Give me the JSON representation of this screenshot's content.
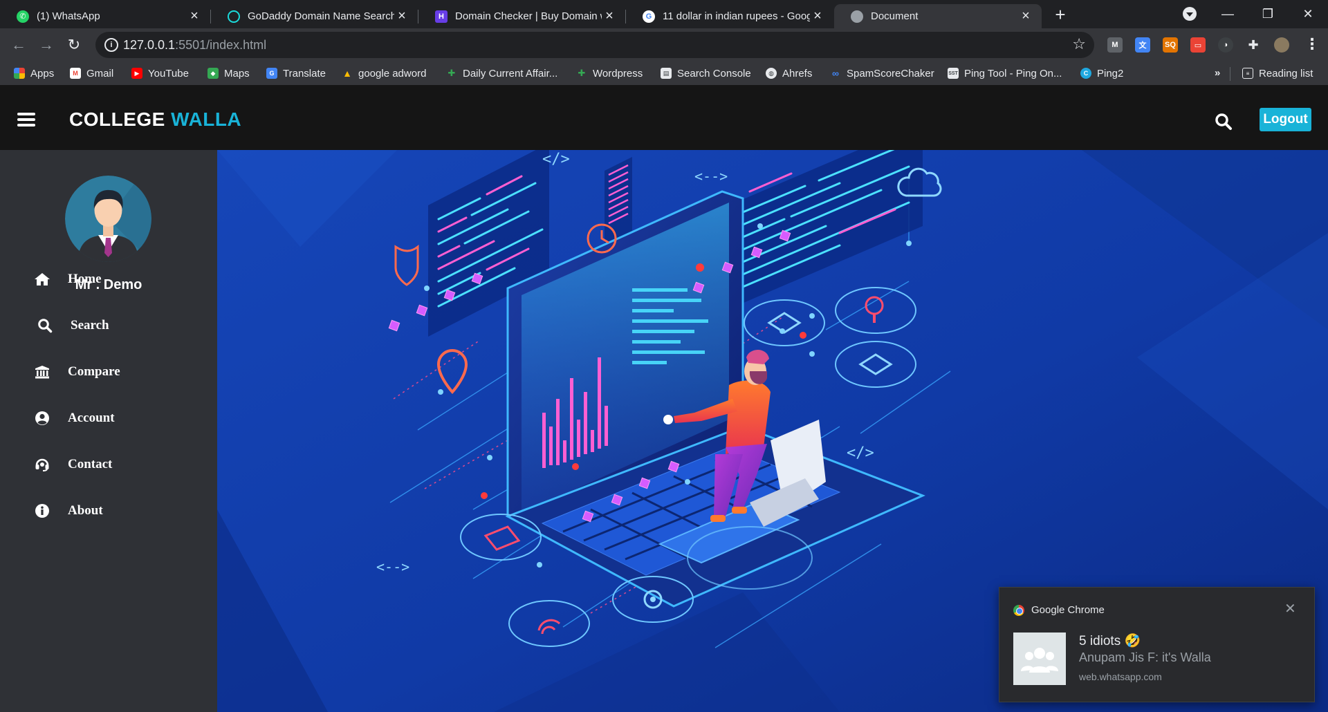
{
  "browser": {
    "tabs": [
      {
        "title": "(1) WhatsApp",
        "icon": "whatsapp-icon",
        "color": "#25d366",
        "active": false
      },
      {
        "title": "GoDaddy Domain Name Search",
        "icon": "godaddy-icon",
        "color": "#1bdbdb",
        "active": false
      },
      {
        "title": "Domain Checker | Buy Domain wi",
        "icon": "hostinger-icon",
        "color": "#673de6",
        "active": false
      },
      {
        "title": "11 dollar in indian rupees - Goog",
        "icon": "google-icon",
        "color": "#4285f4",
        "active": false
      },
      {
        "title": "Document",
        "icon": "globe-icon",
        "color": "#9aa0a6",
        "active": true
      }
    ],
    "url_host": "127.0.0.1",
    "url_path": ":5501/index.html",
    "bookmarks": [
      {
        "label": "Apps",
        "icon": "apps-grid-icon",
        "color": "#ea4335"
      },
      {
        "label": "Gmail",
        "icon": "gmail-icon",
        "color": "#ea4335"
      },
      {
        "label": "YouTube",
        "icon": "youtube-icon",
        "color": "#ff0000"
      },
      {
        "label": "Maps",
        "icon": "maps-icon",
        "color": "#34a853"
      },
      {
        "label": "Translate",
        "icon": "translate-icon",
        "color": "#4285f4"
      },
      {
        "label": "google adword",
        "icon": "google-ads-icon",
        "color": "#fbbc04"
      },
      {
        "label": "Daily Current Affair...",
        "icon": "bookmark-site-icon",
        "color": "#34a853"
      },
      {
        "label": "Wordpress",
        "icon": "bookmark-site-icon",
        "color": "#34a853"
      },
      {
        "label": "Search Console",
        "icon": "search-console-icon",
        "color": "#9aa0a6"
      },
      {
        "label": "Ahrefs",
        "icon": "globe-icon",
        "color": "#9aa0a6"
      },
      {
        "label": "SpamScoreChaker",
        "icon": "link-icon",
        "color": "#4285f4"
      },
      {
        "label": "Ping Tool - Ping On...",
        "icon": "ping-tool-icon",
        "color": "#e8eaed"
      },
      {
        "label": "Ping2",
        "icon": "ping2-icon",
        "color": "#1fa8e0"
      }
    ],
    "more_bookmarks": "»",
    "reading_list": "Reading list"
  },
  "header": {
    "brand_part1": "COLLEGE",
    "brand_part2": "WALLA",
    "logout_label": "Logout",
    "brand_color": "#19b3d8"
  },
  "sidebar": {
    "username": "Mr . Demo",
    "items": [
      {
        "label": "Home",
        "icon": "home-icon"
      },
      {
        "label": "Search",
        "icon": "search-icon"
      },
      {
        "label": "Compare",
        "icon": "university-icon"
      },
      {
        "label": "Account",
        "icon": "user-circle-icon"
      },
      {
        "label": "Contact",
        "icon": "headset-icon"
      },
      {
        "label": "About",
        "icon": "info-circle-icon"
      }
    ]
  },
  "notification": {
    "app": "Google Chrome",
    "title": "5 idiots 🤣",
    "body": "Anupam Jis F: it's Walla",
    "source": "web.whatsapp.com"
  }
}
